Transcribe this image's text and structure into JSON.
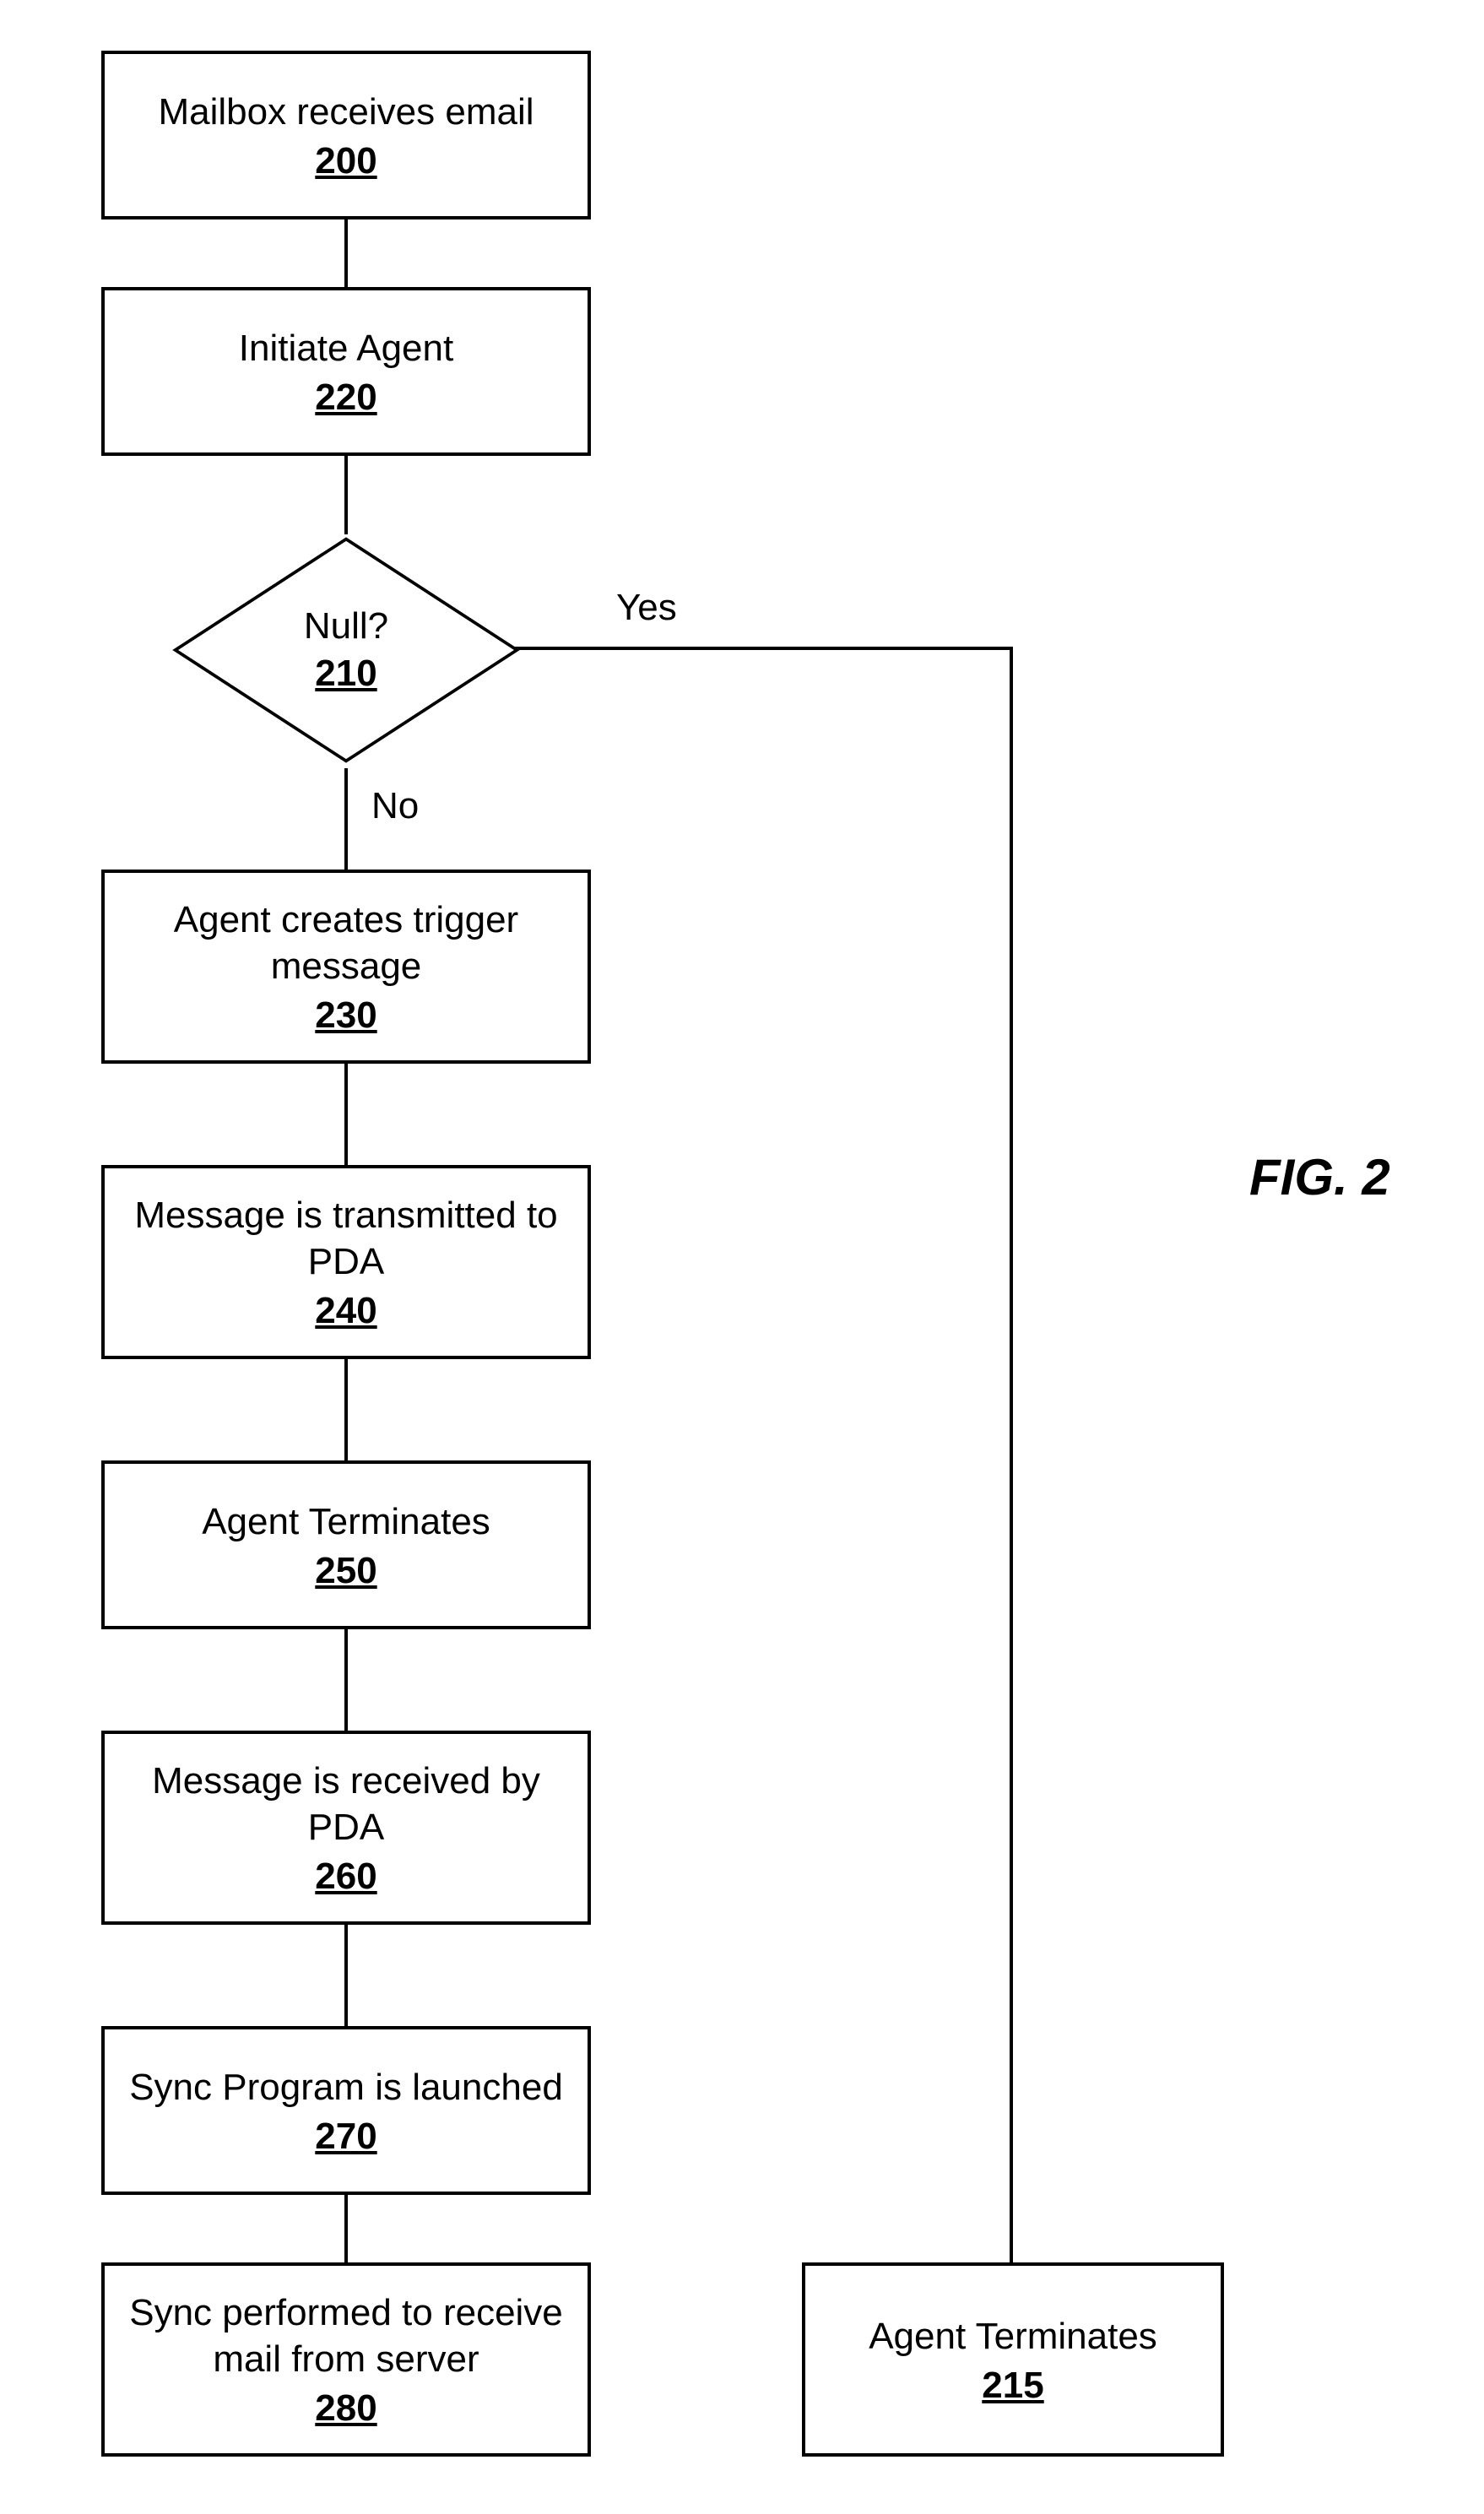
{
  "figure_label": "FIG. 2",
  "decision": {
    "label": "Null?",
    "num": "210",
    "yes": "Yes",
    "no": "No"
  },
  "boxes": {
    "b200": {
      "label": "Mailbox receives email",
      "num": "200"
    },
    "b220": {
      "label": "Initiate Agent",
      "num": "220"
    },
    "b230": {
      "label": "Agent creates trigger message",
      "num": "230"
    },
    "b240": {
      "label": "Message is transmitted to PDA",
      "num": "240"
    },
    "b250": {
      "label": "Agent Terminates",
      "num": "250"
    },
    "b260": {
      "label": "Message is received by PDA",
      "num": "260"
    },
    "b270": {
      "label": "Sync Program is launched",
      "num": "270"
    },
    "b280": {
      "label": "Sync performed to receive mail from server",
      "num": "280"
    },
    "b215": {
      "label": "Agent Terminates",
      "num": "215"
    }
  },
  "chart_data": {
    "type": "flowchart",
    "nodes": [
      {
        "id": "200",
        "type": "process",
        "text": "Mailbox receives email"
      },
      {
        "id": "220",
        "type": "process",
        "text": "Initiate Agent"
      },
      {
        "id": "210",
        "type": "decision",
        "text": "Null?"
      },
      {
        "id": "230",
        "type": "process",
        "text": "Agent creates trigger message"
      },
      {
        "id": "240",
        "type": "process",
        "text": "Message is transmitted to PDA"
      },
      {
        "id": "250",
        "type": "process",
        "text": "Agent Terminates"
      },
      {
        "id": "260",
        "type": "process",
        "text": "Message is received by PDA"
      },
      {
        "id": "270",
        "type": "process",
        "text": "Sync Program is launched"
      },
      {
        "id": "280",
        "type": "process",
        "text": "Sync performed to receive mail from server"
      },
      {
        "id": "215",
        "type": "process",
        "text": "Agent Terminates"
      }
    ],
    "edges": [
      {
        "from": "200",
        "to": "220"
      },
      {
        "from": "220",
        "to": "210"
      },
      {
        "from": "210",
        "to": "230",
        "label": "No"
      },
      {
        "from": "210",
        "to": "215",
        "label": "Yes"
      },
      {
        "from": "230",
        "to": "240"
      },
      {
        "from": "240",
        "to": "250"
      },
      {
        "from": "250",
        "to": "260"
      },
      {
        "from": "260",
        "to": "270"
      },
      {
        "from": "270",
        "to": "280"
      }
    ]
  }
}
